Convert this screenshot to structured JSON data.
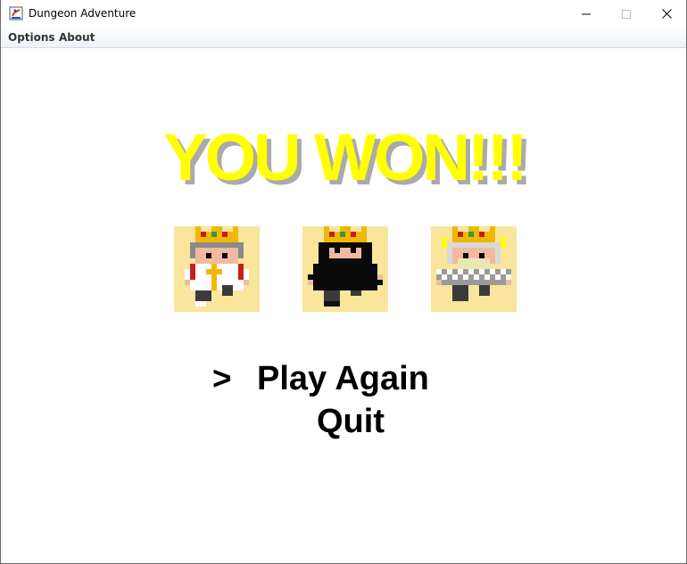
{
  "window": {
    "title": "Dungeon Adventure",
    "icons": {
      "app": "java-app-icon",
      "minimize": "minimize-icon",
      "maximize": "maximize-icon",
      "close": "close-icon"
    }
  },
  "menubar": {
    "items": [
      {
        "label": "Options"
      },
      {
        "label": "About"
      }
    ]
  },
  "game": {
    "title": "YOU WON!!!",
    "title_color": "#ffff00",
    "title_shadow_color": "#aaaaaa",
    "portrait_bg": "#f9e59b",
    "heroes": [
      {
        "role": "priest",
        "crowned": true
      },
      {
        "role": "thief",
        "crowned": true
      },
      {
        "role": "warrior",
        "crowned": true
      }
    ],
    "cursor": ">",
    "options": [
      {
        "label": "Play Again",
        "selected": true
      },
      {
        "label": "Quit",
        "selected": false
      }
    ]
  }
}
